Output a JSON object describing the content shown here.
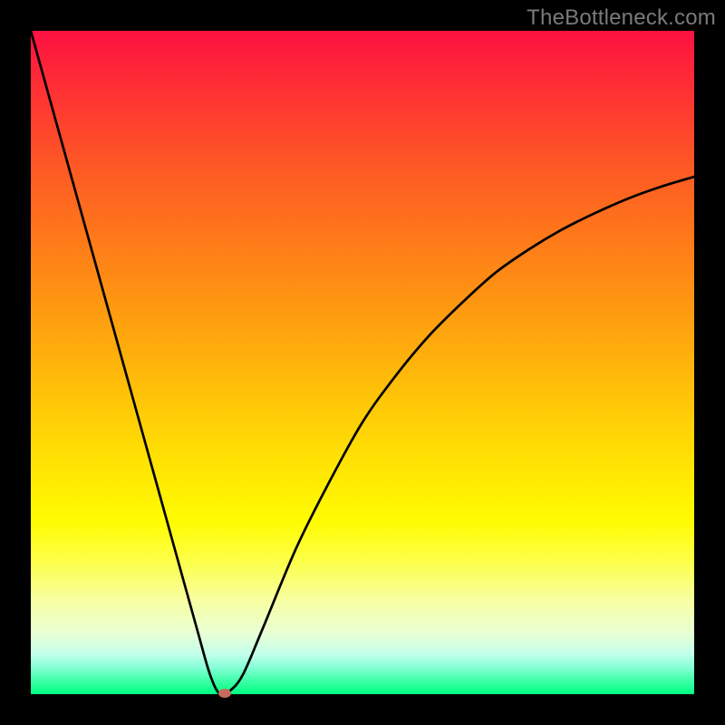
{
  "watermark": "TheBottleneck.com",
  "chart_data": {
    "type": "line",
    "title": "",
    "xlabel": "",
    "ylabel": "",
    "xlim": [
      0,
      100
    ],
    "ylim": [
      0,
      100
    ],
    "grid": false,
    "legend": false,
    "series": [
      {
        "name": "bottleneck-curve",
        "x": [
          0,
          5,
          10,
          15,
          20,
          25,
          27,
          28.5,
          30,
          32,
          35,
          40,
          45,
          50,
          55,
          60,
          65,
          70,
          75,
          80,
          85,
          90,
          95,
          100
        ],
        "values": [
          100,
          82,
          64,
          46,
          28,
          10,
          3,
          0,
          0.5,
          3,
          10,
          22,
          32,
          41,
          48,
          54,
          59,
          63.5,
          67,
          70,
          72.5,
          74.7,
          76.5,
          78
        ]
      }
    ],
    "marker": {
      "x": 29.2,
      "y": 0.2
    },
    "background_gradient": [
      {
        "stop": 0,
        "color": "#fd1141"
      },
      {
        "stop": 10,
        "color": "#fe3432"
      },
      {
        "stop": 20,
        "color": "#fd5725"
      },
      {
        "stop": 32,
        "color": "#fe7b19"
      },
      {
        "stop": 44,
        "color": "#fea00f"
      },
      {
        "stop": 54,
        "color": "#ffc008"
      },
      {
        "stop": 65,
        "color": "#ffe303"
      },
      {
        "stop": 74,
        "color": "#fffc02"
      },
      {
        "stop": 80,
        "color": "#fdff4a"
      },
      {
        "stop": 86,
        "color": "#f7ffa4"
      },
      {
        "stop": 91,
        "color": "#e7ffd6"
      },
      {
        "stop": 94,
        "color": "#c1ffeb"
      },
      {
        "stop": 96,
        "color": "#84ffd6"
      },
      {
        "stop": 98,
        "color": "#3cffa7"
      },
      {
        "stop": 100,
        "color": "#00ff80"
      }
    ]
  }
}
